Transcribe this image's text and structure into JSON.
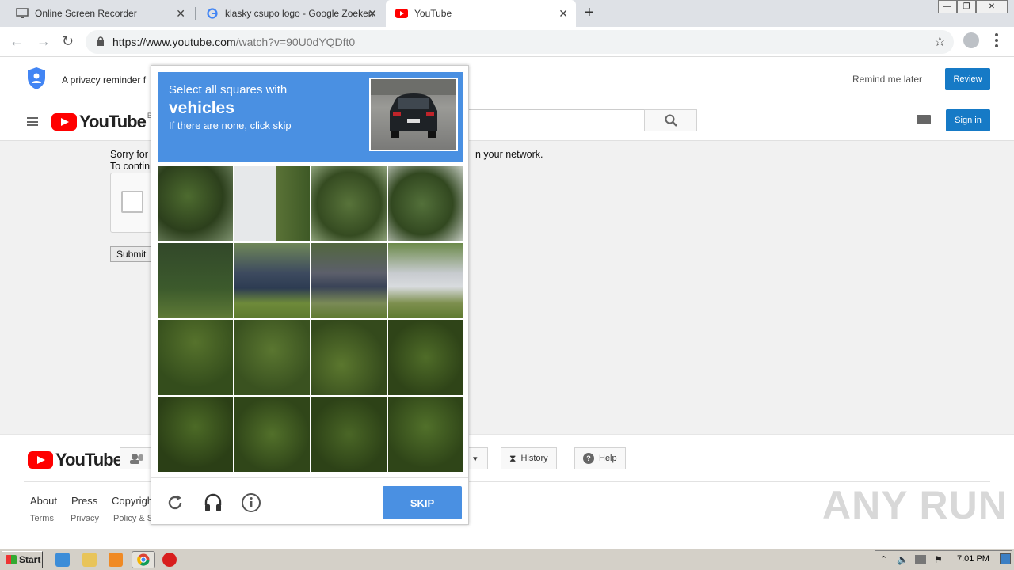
{
  "browser": {
    "tabs": [
      {
        "title": "Online Screen Recorder",
        "active": false
      },
      {
        "title": "klasky csupo logo - Google Zoeken",
        "active": false
      },
      {
        "title": "YouTube",
        "active": true
      }
    ],
    "new_tab_label": "+",
    "url_host": "https://www.youtube.com",
    "url_path": "/watch?v=90U0dYQDft0"
  },
  "privacy_banner": {
    "text": "A privacy reminder f",
    "remind_later": "Remind me later",
    "review_label": "Review"
  },
  "masthead": {
    "logo_text": "YouTube",
    "region": "BE",
    "sign_in_label": "Sign in"
  },
  "page": {
    "sorry_line1": "Sorry for",
    "sorry_line2": "To contin",
    "sorry_tail": "n your network.",
    "submit_label": "Submit"
  },
  "captcha": {
    "instruction_line1": "Select all squares with",
    "target_word": "vehicles",
    "instruction_line3": "If there are none, click skip",
    "skip_label": "SKIP"
  },
  "footer": {
    "logo_text": "YouTube",
    "history_label": "History",
    "help_label": "Help",
    "links_primary": [
      "About",
      "Press",
      "Copyrigh"
    ],
    "links_secondary": [
      "Terms",
      "Privacy",
      "Policy & S"
    ],
    "watermark": "ANY RUN"
  },
  "taskbar": {
    "start_label": "Start",
    "clock": "7:01 PM"
  },
  "colors": {
    "captcha_blue": "#4a90e2",
    "youtube_blue": "#167ac6",
    "youtube_red": "#ff0000"
  }
}
